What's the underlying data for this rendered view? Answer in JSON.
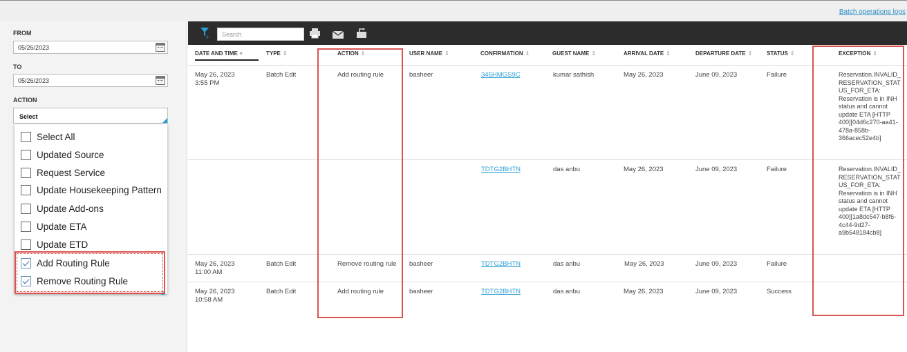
{
  "header": {
    "batch_logs_link": "Batch operations logs"
  },
  "filters": {
    "from_label": "FROM",
    "from_value": "05/26/2023",
    "to_label": "TO",
    "to_value": "05/26/2023",
    "action_label": "ACTION",
    "action_select_value": "Select",
    "action_options": [
      {
        "label": "Select All",
        "checked": false
      },
      {
        "label": "Updated Source",
        "checked": false
      },
      {
        "label": "Request Service",
        "checked": false
      },
      {
        "label": "Update Housekeeping Pattern",
        "checked": false
      },
      {
        "label": "Update Add-ons",
        "checked": false
      },
      {
        "label": "Update ETA",
        "checked": false
      },
      {
        "label": "Update ETD",
        "checked": false
      },
      {
        "label": "Add Routing Rule",
        "checked": true
      },
      {
        "label": "Remove Routing Rule",
        "checked": true
      }
    ]
  },
  "toolbar": {
    "search_placeholder": "Search",
    "icons": [
      "filter-icon",
      "print-icon",
      "email-icon",
      "export-icon"
    ]
  },
  "table": {
    "columns": [
      "DATE AND TIME",
      "TYPE",
      "ACTION",
      "USER NAME",
      "CONFIRMATION",
      "GUEST NAME",
      "ARRIVAL DATE",
      "DEPARTURE DATE",
      "STATUS",
      "EXCEPTION"
    ],
    "sorted_column": "DATE AND TIME",
    "rows": [
      {
        "date": "May 26, 2023",
        "time": "3:55 PM",
        "type": "Batch Edit",
        "action": "Add routing rule",
        "user": "basheer",
        "confirmation": "345HMGS9C",
        "guest": "kumar sathish",
        "arrival": "May 26, 2023",
        "departure": "June 09, 2023",
        "status": "Failure",
        "exception": "Reservation.INVALID_RESERVATION_STATUS_FOR_ETA: Reservation is in INH status and cannot update ETA [HTTP 400][04d6c270-aa41-478a-858b-366acec52e4b]"
      },
      {
        "date": "",
        "time": "",
        "type": "",
        "action": "",
        "user": "",
        "confirmation": "TDTG2BHTN",
        "guest": "das anbu",
        "arrival": "May 26, 2023",
        "departure": "June 09, 2023",
        "status": "Failure",
        "exception": "Reservation.INVALID_RESERVATION_STATUS_FOR_ETA: Reservation is in INH status and cannot update ETA [HTTP 400][1a8dc547-b8f6-4c44-9d27-a9b548184cb8]"
      },
      {
        "date": "May 26, 2023",
        "time": "11:00 AM",
        "type": "Batch Edit",
        "action": "Remove routing rule",
        "user": "basheer",
        "confirmation": "TDTG2BHTN",
        "guest": "das anbu",
        "arrival": "May 26, 2023",
        "departure": "June 09, 2023",
        "status": "Failure",
        "exception": ""
      },
      {
        "date": "May 26, 2023",
        "time": "10:58 AM",
        "type": "Batch Edit",
        "action": "Add routing rule",
        "user": "basheer",
        "confirmation": "TDTG2BHTN",
        "guest": "das anbu",
        "arrival": "May 26, 2023",
        "departure": "June 09, 2023",
        "status": "Success",
        "exception": ""
      }
    ]
  },
  "colors": {
    "accent": "#2a9fd6",
    "toolbar_bg": "#2c2c2c",
    "highlight": "#d9534f"
  }
}
